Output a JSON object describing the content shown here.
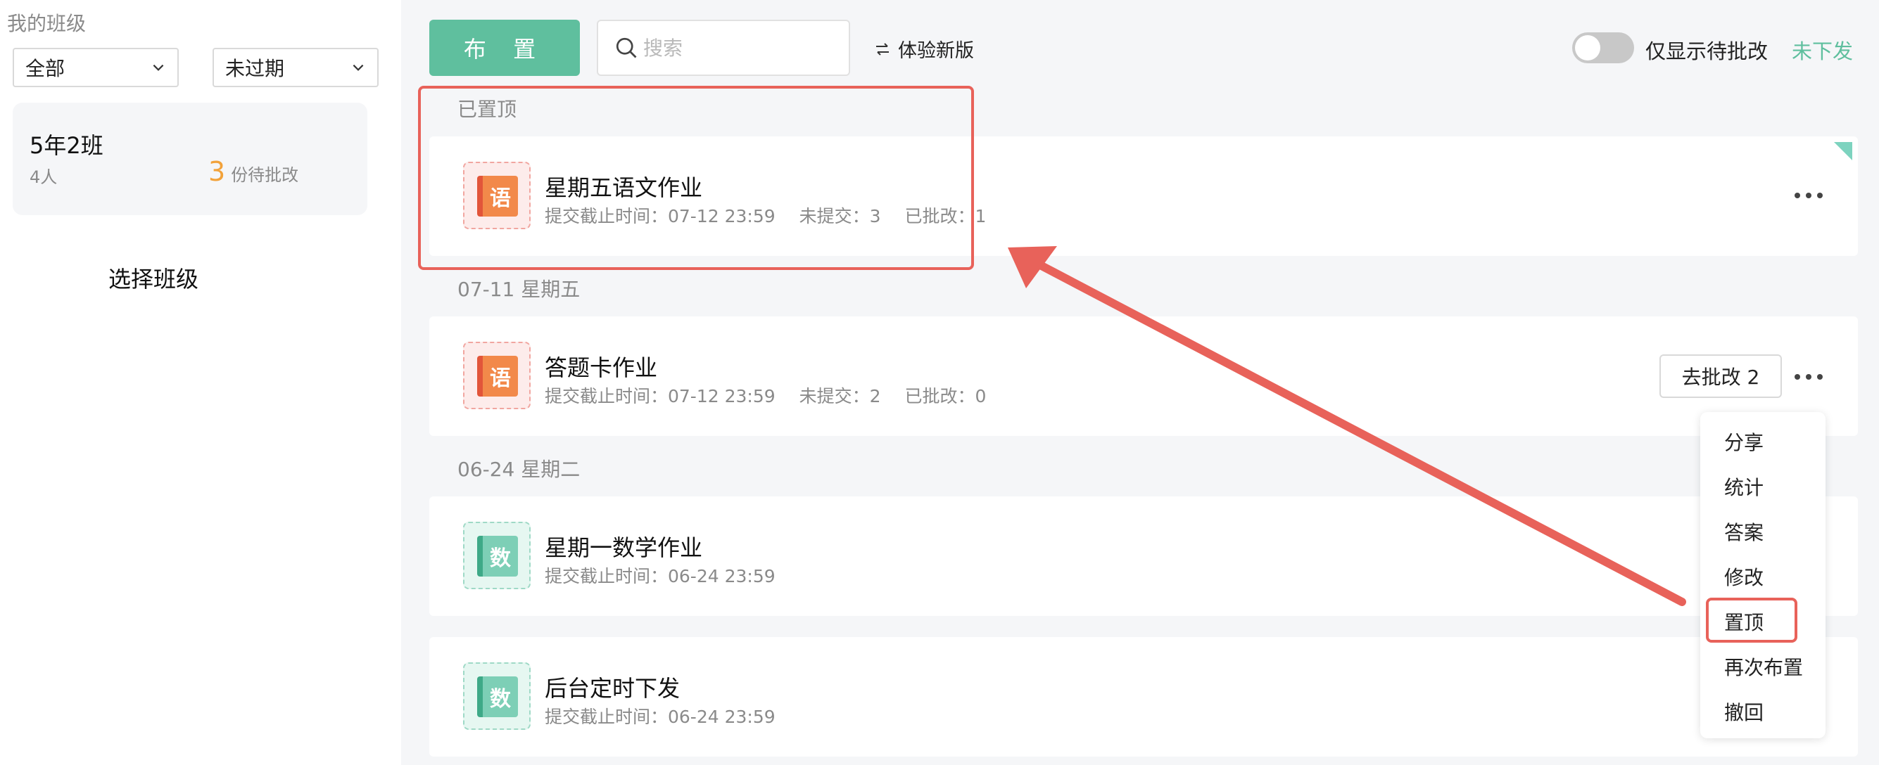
{
  "sidebar": {
    "title": "我的班级",
    "filter_grade": "全部",
    "filter_status": "未过期",
    "class_card": {
      "name": "5年2班",
      "student_count": "4人",
      "pending_num": "3",
      "pending_label": "份待批改"
    },
    "hint": "选择班级"
  },
  "toolbar": {
    "assign_label": "布 置",
    "search_placeholder": "搜索",
    "new_version_label": "体验新版",
    "toggle_label": "仅显示待批改",
    "undelivered_label": "未下发",
    "toggle_on": false
  },
  "groups": [
    {
      "label": "已置顶"
    },
    {
      "label": "07-11 星期五"
    },
    {
      "label": "06-24 星期二"
    }
  ],
  "homeworks": [
    {
      "subject": "语",
      "subject_type": "chinese",
      "title": "星期五语文作业",
      "deadline": "提交截止时间：07-12 23:59",
      "unsubmitted": "未提交：3",
      "reviewed": "已批改：1"
    },
    {
      "subject": "语",
      "subject_type": "chinese",
      "title": "答题卡作业",
      "deadline": "提交截止时间：07-12 23:59",
      "unsubmitted": "未提交：2",
      "reviewed": "已批改：0",
      "review_button": "去批改 2"
    },
    {
      "subject": "数",
      "subject_type": "math",
      "title": "星期一数学作业",
      "deadline": "提交截止时间：06-24 23:59"
    },
    {
      "subject": "数",
      "subject_type": "math",
      "title": "后台定时下发",
      "deadline": "提交截止时间：06-24 23:59"
    }
  ],
  "context_menu": [
    "分享",
    "统计",
    "答案",
    "修改",
    "置顶",
    "再次布置",
    "撤回"
  ],
  "colors": {
    "accent": "#5fbf9e",
    "pending": "#f2a23a",
    "annotation": "#e8625a"
  }
}
